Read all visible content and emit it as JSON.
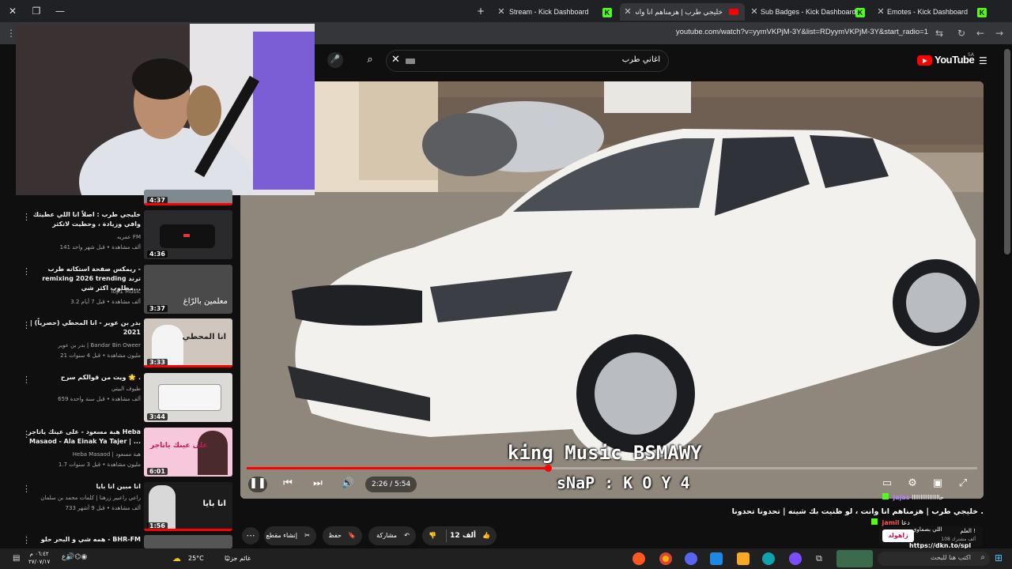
{
  "browser": {
    "tabs": [
      {
        "title": "Stream - Kick Dashboard"
      },
      {
        "title": "خليجي طرب | هزمناهم انا وانت"
      },
      {
        "title": "Sub Badges - Kick Dashboard"
      },
      {
        "title": "Emotes - Kick Dashboard"
      }
    ],
    "url": "youtube.com/watch?v=yymVKPjM-3Y&list=RDyymVKPjM-3Y&start_radio=1"
  },
  "youtube": {
    "search_value": "اغاني طرب",
    "logo_text": "YouTube",
    "country_code": "SA"
  },
  "player": {
    "time_current": "2:26",
    "time_total": "5:54",
    "time_display": "2:26 / 5:54",
    "progress": 0.412,
    "overlay_line1": "king Music BSMAWY",
    "overlay_line2": "sNaP : K O Y 4"
  },
  "video_info": {
    "title": "خليجي طرب | هزمناهم انا وانت ، لو ظنيت بك شينه | تحدونا تحدونا .",
    "likes": "12 ألف",
    "share": "مشاركة",
    "save": "حفظ",
    "clip": "إنشاء مقطع"
  },
  "playlist": [
    {
      "duration": "4:37"
    },
    {
      "title": "خليجي طرب : اصلاً انا اللي عطيتك وافي وزيادة ، وحطيت لاتكثر",
      "channel": "عمريه FM",
      "meta": "141 ألف مشاهدة • قبل شهر واحد",
      "duration": "4:36"
    },
    {
      "title": "ريمكس صفحة استكانه طرب - remixing 2026 trending ترند مطلوب اكثر شي...",
      "channel": "Top1 Music",
      "meta": "3.2 ألف مشاهدة • قبل 7 أيام",
      "duration": "3:37",
      "thumb_text": "معلمين بالرّاغ"
    },
    {
      "title": "بدر بن عوير - انا المحطي (حصرياً) | 2021",
      "channel": "بدر بن عوير | Bandar Bin Oweer",
      "meta": "21 مليون مشاهدة • قبل 4 سنوات",
      "duration": "3:33",
      "thumb_text": "انا المحطي"
    },
    {
      "title": "ويت من قوالكم سرح 🌟 .",
      "channel": "طيوف البيتي",
      "meta": "659 ألف مشاهدة • قبل سنة واحدة",
      "duration": "3:44"
    },
    {
      "title": "هبة مسعود - على عينك ياتاجر Heba Masaod - Ala Einak Ya Tajer | ...",
      "channel": "Heba Masaod | هبة مسعود",
      "meta": "1.7 مليون مشاهدة • قبل 3 سنوات",
      "duration": "6:01",
      "thumb_text": "على عينك ياتاجر"
    },
    {
      "title": "انا مبين انا بايا",
      "channel": "راعي راعبير زرهنا | كلمات محمد بن سلمان",
      "meta": "733 ألف مشاهدة • قبل 9 أشهر",
      "duration": "1:56",
      "thumb_text": "انا بايا"
    },
    {
      "title": "همه شي و البحر حلو - BHR-FM"
    }
  ],
  "chat": [
    {
      "user": "jajas",
      "text": "حاااااااااااااااا"
    },
    {
      "user": "jamil",
      "text": "دعا"
    },
    {
      "user": "",
      "text": "اللي بصماوي"
    },
    {
      "user": "",
      "text": "https://dkn.to/spl"
    }
  ],
  "chat_popup": {
    "name": "زاهولد",
    "sub": "108 ألف مشترك",
    "line": "العلم !"
  },
  "taskbar": {
    "weather_temp": "25°C",
    "weather_text": "غائم جزئيًا",
    "search_text": "اكتب هنا للبحث",
    "time": "٠٦:٤٢ م",
    "date": "٢٧/٠٧/١٧"
  },
  "colors": {
    "youtube_red": "#ff0000",
    "kick_green": "#53fc18",
    "background": "#0f0f0f"
  }
}
